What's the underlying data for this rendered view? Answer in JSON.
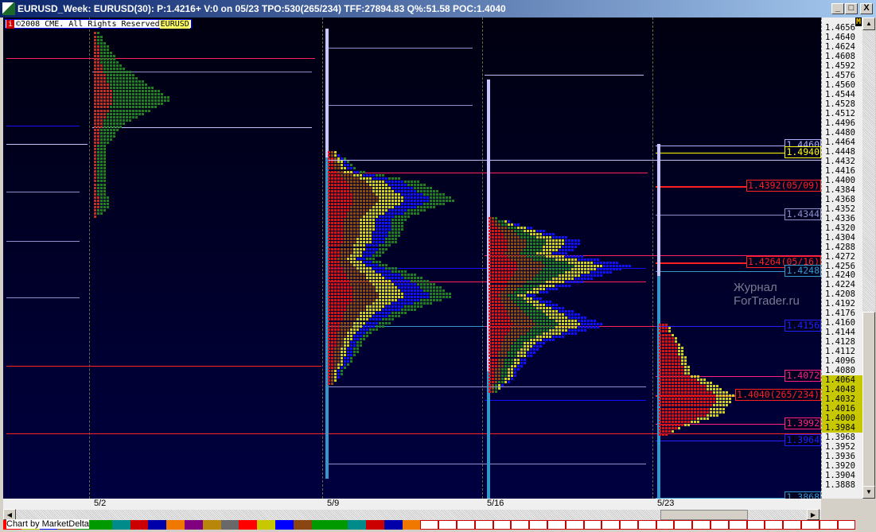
{
  "window": {
    "title": "EURUSD_Week: EURUSD(30): P:1.4216+ V:0 on 05/23 TPO:530(265/234) TFF:27894.83 Q%:51.58 POC:1.4040",
    "buttons": [
      "_",
      "□",
      "X"
    ]
  },
  "chart": {
    "copyright": "©2008 CME. All Rights Reserved",
    "info_icon": "i",
    "symbol": "EURUSD",
    "watermark": "Журнал ForTrader.ru",
    "corner_badge": "M",
    "price_ticks": [
      "1.4656",
      "1.4640",
      "1.4624",
      "1.4608",
      "1.4592",
      "1.4576",
      "1.4560",
      "1.4544",
      "1.4528",
      "1.4512",
      "1.4496",
      "1.4480",
      "1.4464",
      "1.4448",
      "1.4432",
      "1.4416",
      "1.4400",
      "1.4384",
      "1.4368",
      "1.4352",
      "1.4336",
      "1.4320",
      "1.4304",
      "1.4288",
      "1.4272",
      "1.4256",
      "1.4240",
      "1.4224",
      "1.4208",
      "1.4192",
      "1.4176",
      "1.4160",
      "1.4144",
      "1.4128",
      "1.4112",
      "1.4096",
      "1.4080",
      "1.4064",
      "1.4048",
      "1.4032",
      "1.4016",
      "1.4000",
      "1.3984",
      "1.3968",
      "1.3952",
      "1.3936",
      "1.3920",
      "1.3904",
      "1.3888"
    ],
    "value_area_highlight": [
      "1.4064",
      "1.3984"
    ],
    "dates": [
      "5/2",
      "5/9",
      "5/16",
      "5/23"
    ],
    "level_labels": [
      {
        "text": "1.4460",
        "price": 1.446,
        "color": "#b0b0ff"
      },
      {
        "text": "1.4940",
        "price": 1.4448,
        "color": "#ffff00"
      },
      {
        "text": "1.4392(05/09)",
        "price": 1.4392,
        "color": "#ff2020"
      },
      {
        "text": "1.4344",
        "price": 1.4344,
        "color": "#9090d0"
      },
      {
        "text": "1.4264(05/16)",
        "price": 1.4264,
        "color": "#ff2020"
      },
      {
        "text": "1.4248",
        "price": 1.4248,
        "color": "#3399cc"
      },
      {
        "text": "1.4156",
        "price": 1.4156,
        "color": "#2020ff"
      },
      {
        "text": "1.4072",
        "price": 1.4072,
        "color": "#ff2080"
      },
      {
        "text": "1.4040(265/234)",
        "price": 1.404,
        "color": "#ff2020"
      },
      {
        "text": "1.3992",
        "price": 1.3992,
        "color": "#ff2080"
      },
      {
        "text": "1.3964",
        "price": 1.3964,
        "color": "#2020ff"
      },
      {
        "text": "1.3868",
        "price": 1.3868,
        "color": "#3399cc"
      }
    ],
    "profiles": [
      {
        "date": "5/2",
        "high": 1.465,
        "low": 1.434,
        "poc": 1.454,
        "colors": [
          "#c03020",
          "#208020",
          "#208020",
          "#208020"
        ],
        "shape": [
          [
            1.465,
            2
          ],
          [
            1.46,
            8
          ],
          [
            1.456,
            18
          ],
          [
            1.454,
            25
          ],
          [
            1.45,
            10
          ],
          [
            1.446,
            4
          ],
          [
            1.44,
            4
          ],
          [
            1.436,
            5
          ],
          [
            1.434,
            1
          ]
        ]
      },
      {
        "date": "5/9",
        "high": 1.445,
        "low": 1.406,
        "poc": 1.4392,
        "colors": [
          "#e01010",
          "#8a4a10",
          "#d0d020",
          "#1010ff",
          "#208020"
        ],
        "shape": [
          [
            1.445,
            3
          ],
          [
            1.442,
            10
          ],
          [
            1.44,
            30
          ],
          [
            1.437,
            40
          ],
          [
            1.434,
            25
          ],
          [
            1.43,
            22
          ],
          [
            1.427,
            15
          ],
          [
            1.424,
            30
          ],
          [
            1.421,
            40
          ],
          [
            1.418,
            25
          ],
          [
            1.414,
            12
          ],
          [
            1.41,
            8
          ],
          [
            1.406,
            2
          ]
        ]
      },
      {
        "date": "5/16",
        "high": 1.434,
        "low": 1.4045,
        "poc": 1.4264,
        "colors": [
          "#e01010",
          "#8a4a10",
          "#208020",
          "#d0d020",
          "#1010ff"
        ],
        "shape": [
          [
            1.434,
            3
          ],
          [
            1.43,
            30
          ],
          [
            1.428,
            25
          ],
          [
            1.426,
            45
          ],
          [
            1.424,
            35
          ],
          [
            1.421,
            15
          ],
          [
            1.418,
            28
          ],
          [
            1.416,
            37
          ],
          [
            1.413,
            18
          ],
          [
            1.41,
            12
          ],
          [
            1.407,
            8
          ],
          [
            1.4045,
            2
          ]
        ]
      },
      {
        "date": "5/23",
        "high": 1.416,
        "low": 1.3975,
        "poc": 1.404,
        "colors": [
          "#e01010",
          "#e01010",
          "#e01010",
          "#d0d020"
        ],
        "shape": [
          [
            1.416,
            3
          ],
          [
            1.412,
            8
          ],
          [
            1.408,
            10
          ],
          [
            1.406,
            18
          ],
          [
            1.404,
            24
          ],
          [
            1.401,
            20
          ],
          [
            1.399,
            8
          ],
          [
            1.3975,
            2
          ]
        ]
      }
    ]
  },
  "footer": {
    "credit": "Chart by MarketDelta",
    "palette": [
      "#ff0000",
      "#c8c800",
      "#0000ff",
      "#8b4513",
      "#009900",
      "#009900",
      "#008b8b",
      "#cc0000",
      "#0000aa",
      "#f07800",
      "#800080",
      "#b8860b",
      "#696969",
      "#ff0000",
      "#c8c800",
      "#0000ff",
      "#8b4513",
      "#009900",
      "#009900",
      "#008b8b",
      "#cc0000",
      "#0000aa",
      "#f07800",
      "#ffffff",
      "#ffffff",
      "#ffffff",
      "#ffffff",
      "#ffffff",
      "#ffffff",
      "#ffffff",
      "#ffffff",
      "#ffffff",
      "#ffffff",
      "#ffffff",
      "#ffffff",
      "#ffffff",
      "#ffffff",
      "#ffffff",
      "#ffffff",
      "#ffffff",
      "#ffffff",
      "#ffffff",
      "#ffffff",
      "#ffffff",
      "#ffffff",
      "#ffffff",
      "#ffffff"
    ]
  }
}
